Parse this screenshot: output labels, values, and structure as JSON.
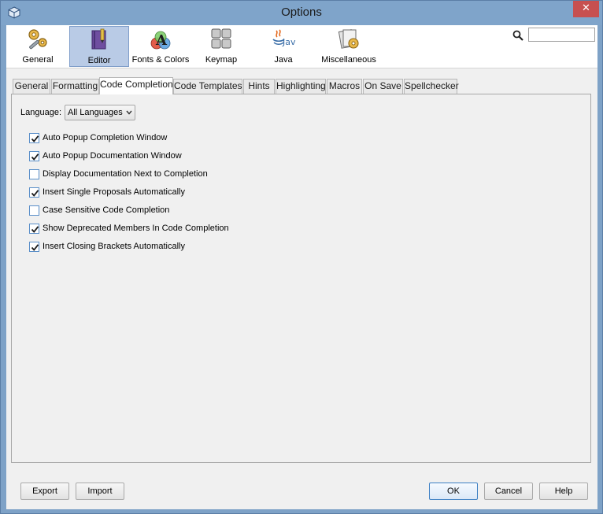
{
  "window": {
    "title": "Options"
  },
  "toolbar": {
    "categories": [
      {
        "label": "General",
        "icon": "gear-wrench-icon"
      },
      {
        "label": "Editor",
        "icon": "editor-book-icon"
      },
      {
        "label": "Fonts & Colors",
        "icon": "fonts-colors-icon"
      },
      {
        "label": "Keymap",
        "icon": "keyboard-icon"
      },
      {
        "label": "Java",
        "icon": "java-icon"
      },
      {
        "label": "Miscellaneous",
        "icon": "miscellaneous-icon"
      }
    ],
    "selected": "Editor",
    "search": {
      "value": "",
      "placeholder": ""
    }
  },
  "tabs": [
    {
      "label": "General"
    },
    {
      "label": "Formatting"
    },
    {
      "label": "Code Completion"
    },
    {
      "label": "Code Templates"
    },
    {
      "label": "Hints"
    },
    {
      "label": "Highlighting"
    },
    {
      "label": "Macros"
    },
    {
      "label": "On Save"
    },
    {
      "label": "Spellchecker"
    }
  ],
  "active_tab": "Code Completion",
  "panel": {
    "language_label": "Language:",
    "language_value": "All Languages",
    "options": [
      {
        "label": "Auto Popup Completion Window",
        "checked": true
      },
      {
        "label": "Auto Popup Documentation Window",
        "checked": true
      },
      {
        "label": "Display Documentation Next to Completion",
        "checked": false
      },
      {
        "label": "Insert Single Proposals Automatically",
        "checked": true
      },
      {
        "label": "Case Sensitive Code Completion",
        "checked": false
      },
      {
        "label": "Show Deprecated Members In Code Completion",
        "checked": true
      },
      {
        "label": "Insert Closing Brackets Automatically",
        "checked": true
      }
    ]
  },
  "buttons": {
    "export": "Export",
    "import": "Import",
    "ok": "OK",
    "cancel": "Cancel",
    "help": "Help"
  },
  "colors": {
    "title_bar": "#7fa4ca",
    "close_button": "#c75050",
    "selected_category": "#b9cbe6",
    "checkbox_border": "#5a8fc9"
  }
}
